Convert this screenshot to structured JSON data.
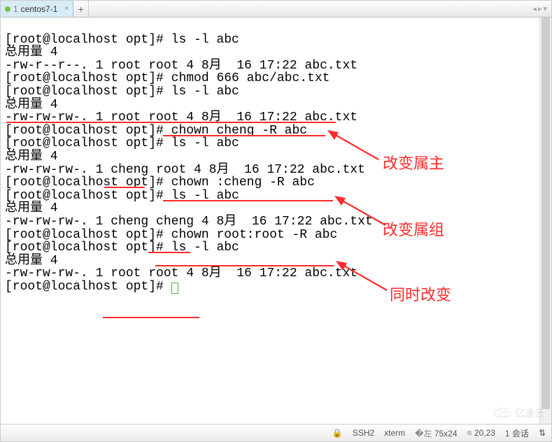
{
  "tab": {
    "num": "1",
    "title": "centos7-1",
    "close": "×"
  },
  "addtab": "+",
  "navright": {
    "left": "◂",
    "right": "▸",
    "menu": "▾"
  },
  "prompt": "[root@localhost opt]# ",
  "lines": {
    "l0": "ls -l abc",
    "l1": "总用量 4",
    "l2": "-rw-r--r--. 1 root root 4 8月  16 17:22 abc.txt",
    "l3": "chmod 666 abc/abc.txt",
    "l4": "ls -l abc",
    "l5": "总用量 4",
    "l6": "-rw-rw-rw-. 1 root root 4 8月  16 17:22 abc.txt",
    "l7": "chown cheng -R abc",
    "l8": "ls -l abc",
    "l9": "总用量 4",
    "l10": "-rw-rw-rw-. 1 cheng root 4 8月  16 17:22 abc.txt",
    "l11": "chown :cheng -R abc",
    "l12": "ls -l abc",
    "l13": "总用量 4",
    "l14": "-rw-rw-rw-. 1 cheng cheng 4 8月  16 17:22 abc.txt",
    "l15": "chown root:root -R abc",
    "l16": "ls -l abc",
    "l17": "总用量 4",
    "l18": "-rw-rw-rw-. 1 root root 4 8月  16 17:22 abc.txt"
  },
  "annot": {
    "a1": "改变属主",
    "a2": "改变属组",
    "a3": "同时改变"
  },
  "status": {
    "proto": "SSH2",
    "term": "xterm",
    "size": "75x24",
    "pos": "20,23",
    "sess": "1 会话",
    "arrows": "⇅"
  },
  "watermark": "亿速云"
}
